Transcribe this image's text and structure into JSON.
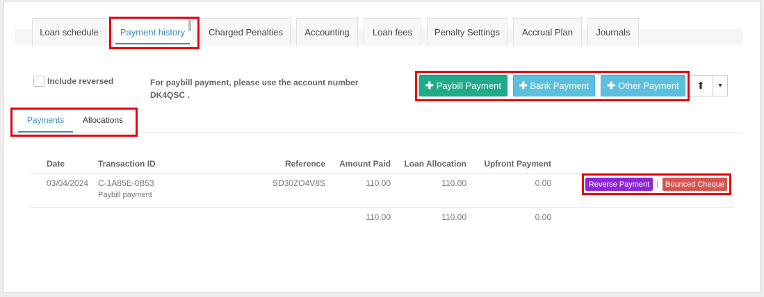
{
  "tabs": [
    {
      "label": "Loan schedule"
    },
    {
      "label": "Payment history"
    },
    {
      "label": "Charged Penalties"
    },
    {
      "label": "Accounting"
    },
    {
      "label": "Loan fees"
    },
    {
      "label": "Penalty Settings"
    },
    {
      "label": "Accrual Plan"
    },
    {
      "label": "Journals"
    }
  ],
  "active_tab": "Payment history",
  "include_reversed_label": "Include reversed",
  "paybill_note": "For paybill payment, please use the account number DK4QSC .",
  "buttons": {
    "paybill": "Paybill Payment",
    "bank": "Bank Payment",
    "other": "Other Payment",
    "plus_glyph": "✚",
    "export_glyph": "⬆",
    "caret_glyph": "▾"
  },
  "subtabs": [
    {
      "label": "Payments"
    },
    {
      "label": "Allocations"
    }
  ],
  "table": {
    "headers": [
      "Date",
      "Transaction ID",
      "Reference",
      "Amount Paid",
      "Loan Allocation",
      "Upfront Payment"
    ],
    "rows": [
      {
        "date": "03/04/2024",
        "transaction_id": "C-1A85E-0B53",
        "method": "Paybill payment",
        "reference": "SD30ZO4V8S",
        "amount_paid": "110.00",
        "loan_allocation": "110.00",
        "upfront_payment": "0.00"
      }
    ],
    "totals": {
      "amount_paid": "110.00",
      "loan_allocation": "110.00",
      "upfront_payment": "0.00"
    }
  },
  "row_actions": {
    "reverse": "Reverse Payment",
    "separator": "|",
    "bounced": "Bounced Cheque"
  },
  "colors": {
    "primary": "#3c8dbc",
    "success": "#1fab89",
    "info": "#5bc0de",
    "reverse": "#8e24d8",
    "bounced": "#d9534f",
    "highlight": "#e8000b"
  }
}
